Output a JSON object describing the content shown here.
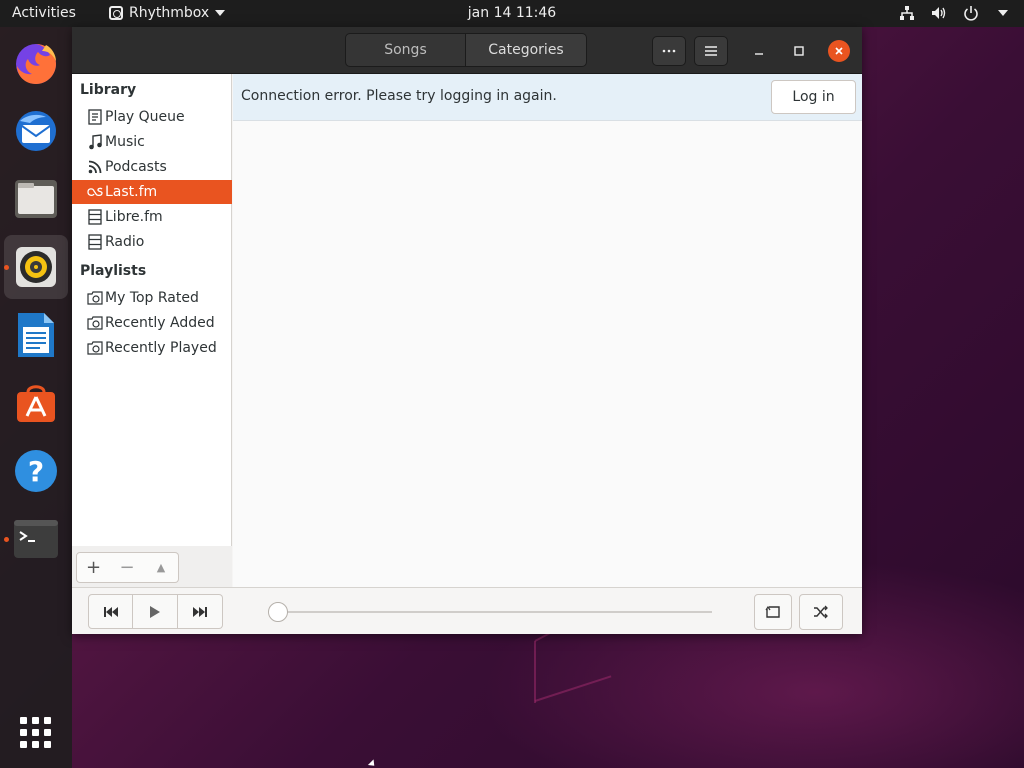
{
  "topbar": {
    "activities": "Activities",
    "app_name": "Rhythmbox",
    "clock": "jan 14  11:46",
    "tray_icons": [
      "network-icon",
      "volume-icon",
      "power-icon",
      "chevron-down-icon"
    ]
  },
  "dock": {
    "items": [
      "firefox",
      "thunderbird",
      "files",
      "rhythmbox",
      "libreoffice-writer",
      "ubuntu-software",
      "help",
      "terminal"
    ],
    "active": "rhythmbox",
    "running": [
      "rhythmbox",
      "terminal"
    ],
    "show_apps_icon": "grid-icon"
  },
  "window": {
    "view_switch": {
      "songs": "Songs",
      "categories": "Categories"
    },
    "headerbar_icons": [
      "more-icon",
      "menu-icon",
      "minimize-icon",
      "maximize-icon",
      "close-icon"
    ],
    "sidebar": {
      "library_heading": "Library",
      "library_items": [
        {
          "label": "Play Queue",
          "icon": "play-queue-icon"
        },
        {
          "label": "Music",
          "icon": "music-note-icon"
        },
        {
          "label": "Podcasts",
          "icon": "rss-icon"
        },
        {
          "label": "Last.fm",
          "icon": "lastfm-icon",
          "selected": true
        },
        {
          "label": "Libre.fm",
          "icon": "server-icon"
        },
        {
          "label": "Radio",
          "icon": "radio-icon"
        }
      ],
      "playlists_heading": "Playlists",
      "playlist_items": [
        {
          "label": "My Top Rated",
          "icon": "smart-playlist-icon"
        },
        {
          "label": "Recently Added",
          "icon": "smart-playlist-icon"
        },
        {
          "label": "Recently Played",
          "icon": "smart-playlist-icon"
        }
      ],
      "toolbar": {
        "add": "+",
        "remove": "−",
        "eject": "▲"
      }
    },
    "infobar": {
      "message": "Connection error. Please try logging in again.",
      "login_label": "Log in"
    },
    "player": {
      "buttons": [
        "previous-icon",
        "play-icon",
        "next-icon"
      ],
      "seek_progress": 0,
      "right_buttons": [
        "repeat-icon",
        "shuffle-icon"
      ]
    },
    "colors": {
      "accent": "#e95420",
      "headerbar": "#2d2d2d",
      "infobar": "#e5f0f8"
    }
  }
}
